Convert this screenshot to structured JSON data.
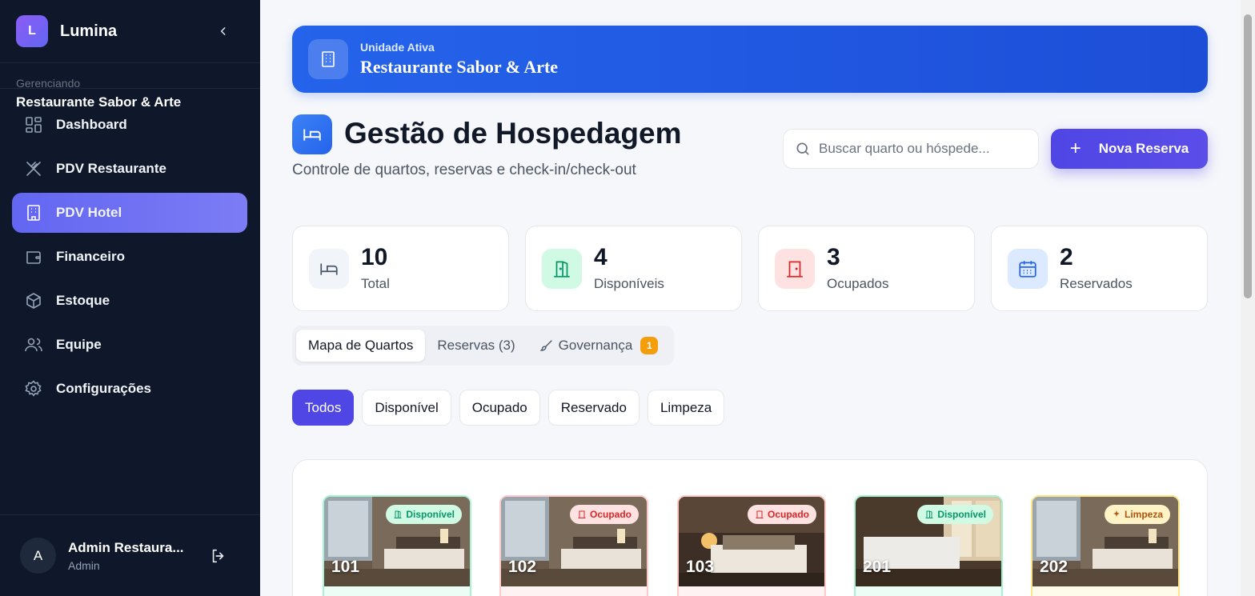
{
  "sidebar": {
    "brand_initial": "L",
    "brand_name": "Lumina",
    "managing_label": "Gerenciando",
    "managing_name": "Restaurante Sabor & Arte",
    "items": [
      {
        "label": "Dashboard",
        "icon": "grid-icon"
      },
      {
        "label": "PDV Restaurante",
        "icon": "utensils-icon"
      },
      {
        "label": "PDV Hotel",
        "icon": "building-icon",
        "active": true
      },
      {
        "label": "Financeiro",
        "icon": "wallet-icon"
      },
      {
        "label": "Estoque",
        "icon": "box-icon"
      },
      {
        "label": "Equipe",
        "icon": "users-icon"
      },
      {
        "label": "Configurações",
        "icon": "gear-icon"
      }
    ],
    "user": {
      "initial": "A",
      "name": "Admin Restaura...",
      "role": "Admin"
    }
  },
  "banner": {
    "label": "Unidade Ativa",
    "title": "Restaurante Sabor & Arte"
  },
  "header": {
    "title": "Gestão de Hospedagem",
    "subtitle": "Controle de quartos, reservas e check-in/check-out",
    "search_placeholder": "Buscar quarto ou hóspede...",
    "new_button": "Nova Reserva"
  },
  "stats": [
    {
      "value": "10",
      "label": "Total",
      "color": "#475569",
      "bg": "#f1f5f9"
    },
    {
      "value": "4",
      "label": "Disponíveis",
      "color": "#059669",
      "bg": "#d1fae5"
    },
    {
      "value": "3",
      "label": "Ocupados",
      "color": "#dc2626",
      "bg": "#fee2e2"
    },
    {
      "value": "2",
      "label": "Reservados",
      "color": "#2563eb",
      "bg": "#dbeafe"
    }
  ],
  "tabs": [
    {
      "label": "Mapa de Quartos"
    },
    {
      "label": "Reservas (3)"
    },
    {
      "label": "Governança",
      "badge": "1"
    }
  ],
  "filters": [
    "Todos",
    "Disponível",
    "Ocupado",
    "Reservado",
    "Limpeza"
  ],
  "rooms": [
    {
      "number": "101",
      "status": "Disponível",
      "color": "#059669",
      "bg": "#d1fae5",
      "border": "#a7f3d0"
    },
    {
      "number": "102",
      "status": "Ocupado",
      "color": "#dc2626",
      "bg": "#fee2e2",
      "border": "#fecaca"
    },
    {
      "number": "103",
      "status": "Ocupado",
      "color": "#dc2626",
      "bg": "#fee2e2",
      "border": "#fecaca"
    },
    {
      "number": "201",
      "status": "Disponível",
      "color": "#059669",
      "bg": "#d1fae5",
      "border": "#a7f3d0"
    },
    {
      "number": "202",
      "status": "Limpeza",
      "color": "#b45309",
      "bg": "#fef3c7",
      "border": "#fde68a"
    }
  ]
}
